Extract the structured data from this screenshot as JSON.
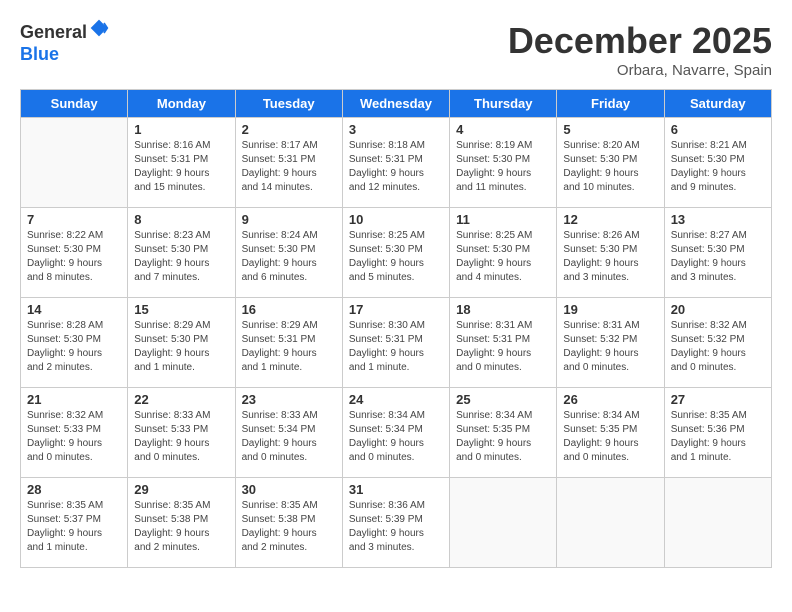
{
  "header": {
    "logo_line1": "General",
    "logo_line2": "Blue",
    "month": "December 2025",
    "location": "Orbara, Navarre, Spain"
  },
  "weekdays": [
    "Sunday",
    "Monday",
    "Tuesday",
    "Wednesday",
    "Thursday",
    "Friday",
    "Saturday"
  ],
  "weeks": [
    [
      {
        "day": "",
        "info": ""
      },
      {
        "day": "1",
        "info": "Sunrise: 8:16 AM\nSunset: 5:31 PM\nDaylight: 9 hours\nand 15 minutes."
      },
      {
        "day": "2",
        "info": "Sunrise: 8:17 AM\nSunset: 5:31 PM\nDaylight: 9 hours\nand 14 minutes."
      },
      {
        "day": "3",
        "info": "Sunrise: 8:18 AM\nSunset: 5:31 PM\nDaylight: 9 hours\nand 12 minutes."
      },
      {
        "day": "4",
        "info": "Sunrise: 8:19 AM\nSunset: 5:30 PM\nDaylight: 9 hours\nand 11 minutes."
      },
      {
        "day": "5",
        "info": "Sunrise: 8:20 AM\nSunset: 5:30 PM\nDaylight: 9 hours\nand 10 minutes."
      },
      {
        "day": "6",
        "info": "Sunrise: 8:21 AM\nSunset: 5:30 PM\nDaylight: 9 hours\nand 9 minutes."
      }
    ],
    [
      {
        "day": "7",
        "info": "Sunrise: 8:22 AM\nSunset: 5:30 PM\nDaylight: 9 hours\nand 8 minutes."
      },
      {
        "day": "8",
        "info": "Sunrise: 8:23 AM\nSunset: 5:30 PM\nDaylight: 9 hours\nand 7 minutes."
      },
      {
        "day": "9",
        "info": "Sunrise: 8:24 AM\nSunset: 5:30 PM\nDaylight: 9 hours\nand 6 minutes."
      },
      {
        "day": "10",
        "info": "Sunrise: 8:25 AM\nSunset: 5:30 PM\nDaylight: 9 hours\nand 5 minutes."
      },
      {
        "day": "11",
        "info": "Sunrise: 8:25 AM\nSunset: 5:30 PM\nDaylight: 9 hours\nand 4 minutes."
      },
      {
        "day": "12",
        "info": "Sunrise: 8:26 AM\nSunset: 5:30 PM\nDaylight: 9 hours\nand 3 minutes."
      },
      {
        "day": "13",
        "info": "Sunrise: 8:27 AM\nSunset: 5:30 PM\nDaylight: 9 hours\nand 3 minutes."
      }
    ],
    [
      {
        "day": "14",
        "info": "Sunrise: 8:28 AM\nSunset: 5:30 PM\nDaylight: 9 hours\nand 2 minutes."
      },
      {
        "day": "15",
        "info": "Sunrise: 8:29 AM\nSunset: 5:30 PM\nDaylight: 9 hours\nand 1 minute."
      },
      {
        "day": "16",
        "info": "Sunrise: 8:29 AM\nSunset: 5:31 PM\nDaylight: 9 hours\nand 1 minute."
      },
      {
        "day": "17",
        "info": "Sunrise: 8:30 AM\nSunset: 5:31 PM\nDaylight: 9 hours\nand 1 minute."
      },
      {
        "day": "18",
        "info": "Sunrise: 8:31 AM\nSunset: 5:31 PM\nDaylight: 9 hours\nand 0 minutes."
      },
      {
        "day": "19",
        "info": "Sunrise: 8:31 AM\nSunset: 5:32 PM\nDaylight: 9 hours\nand 0 minutes."
      },
      {
        "day": "20",
        "info": "Sunrise: 8:32 AM\nSunset: 5:32 PM\nDaylight: 9 hours\nand 0 minutes."
      }
    ],
    [
      {
        "day": "21",
        "info": "Sunrise: 8:32 AM\nSunset: 5:33 PM\nDaylight: 9 hours\nand 0 minutes."
      },
      {
        "day": "22",
        "info": "Sunrise: 8:33 AM\nSunset: 5:33 PM\nDaylight: 9 hours\nand 0 minutes."
      },
      {
        "day": "23",
        "info": "Sunrise: 8:33 AM\nSunset: 5:34 PM\nDaylight: 9 hours\nand 0 minutes."
      },
      {
        "day": "24",
        "info": "Sunrise: 8:34 AM\nSunset: 5:34 PM\nDaylight: 9 hours\nand 0 minutes."
      },
      {
        "day": "25",
        "info": "Sunrise: 8:34 AM\nSunset: 5:35 PM\nDaylight: 9 hours\nand 0 minutes."
      },
      {
        "day": "26",
        "info": "Sunrise: 8:34 AM\nSunset: 5:35 PM\nDaylight: 9 hours\nand 0 minutes."
      },
      {
        "day": "27",
        "info": "Sunrise: 8:35 AM\nSunset: 5:36 PM\nDaylight: 9 hours\nand 1 minute."
      }
    ],
    [
      {
        "day": "28",
        "info": "Sunrise: 8:35 AM\nSunset: 5:37 PM\nDaylight: 9 hours\nand 1 minute."
      },
      {
        "day": "29",
        "info": "Sunrise: 8:35 AM\nSunset: 5:38 PM\nDaylight: 9 hours\nand 2 minutes."
      },
      {
        "day": "30",
        "info": "Sunrise: 8:35 AM\nSunset: 5:38 PM\nDaylight: 9 hours\nand 2 minutes."
      },
      {
        "day": "31",
        "info": "Sunrise: 8:36 AM\nSunset: 5:39 PM\nDaylight: 9 hours\nand 3 minutes."
      },
      {
        "day": "",
        "info": ""
      },
      {
        "day": "",
        "info": ""
      },
      {
        "day": "",
        "info": ""
      }
    ]
  ]
}
